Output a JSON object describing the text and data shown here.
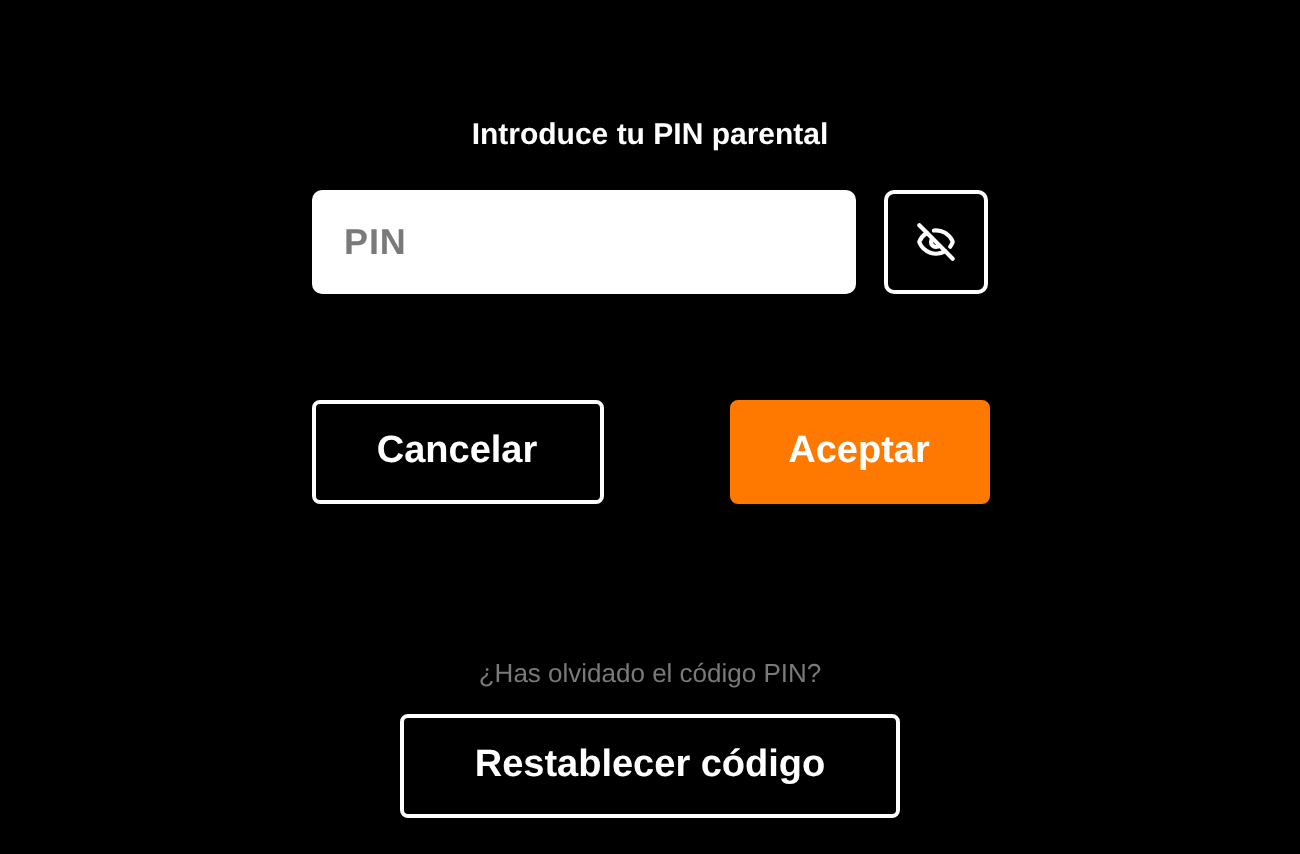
{
  "title": "Introduce tu PIN parental",
  "pin_field": {
    "placeholder": "PIN"
  },
  "buttons": [
    {
      "label": "Cancelar",
      "kind": "outline"
    },
    {
      "label": "Aceptar",
      "kind": "primary"
    }
  ],
  "hint": "¿Has olvidado el código PIN?",
  "reset_button": {
    "label": "Restablecer código"
  }
}
